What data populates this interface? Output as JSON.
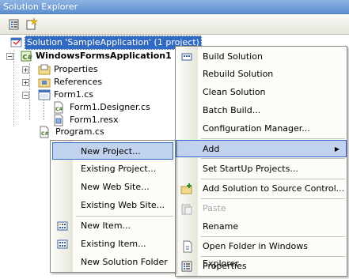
{
  "window": {
    "title": "Solution Explorer"
  },
  "toolbar": {
    "properties_icon": "properties-icon",
    "show_all_icon": "show-all-files-icon"
  },
  "tree": {
    "solution": "Solution 'SampleApplication' (1 project)",
    "project": "WindowsFormsApplication1",
    "properties": "Properties",
    "references": "References",
    "form1": "Form1.cs",
    "form1_designer": "Form1.Designer.cs",
    "form1_resx": "Form1.resx",
    "program": "Program.cs"
  },
  "context_menu": {
    "items": [
      {
        "label": "Build Solution"
      },
      {
        "label": "Rebuild Solution"
      },
      {
        "label": "Clean Solution"
      },
      {
        "label": "Batch Build..."
      },
      {
        "label": "Configuration Manager..."
      },
      {
        "label": "Add"
      },
      {
        "label": "Set StartUp Projects..."
      },
      {
        "label": "Add Solution to Source Control..."
      },
      {
        "label": "Paste"
      },
      {
        "label": "Rename"
      },
      {
        "label": "Open Folder in Windows Explorer"
      },
      {
        "label": "Properties"
      }
    ],
    "submenu_arrow": "▶"
  },
  "add_submenu": {
    "items": [
      {
        "label": "New Project..."
      },
      {
        "label": "Existing Project..."
      },
      {
        "label": "New Web Site..."
      },
      {
        "label": "Existing Web Site..."
      },
      {
        "label": "New Item..."
      },
      {
        "label": "Existing Item..."
      },
      {
        "label": "New Solution Folder"
      }
    ]
  },
  "colors": {
    "highlight": "#c1d2ee",
    "highlight_border": "#316ac5",
    "selection": "#316ac5",
    "titlebar": "#5e8fcf"
  }
}
